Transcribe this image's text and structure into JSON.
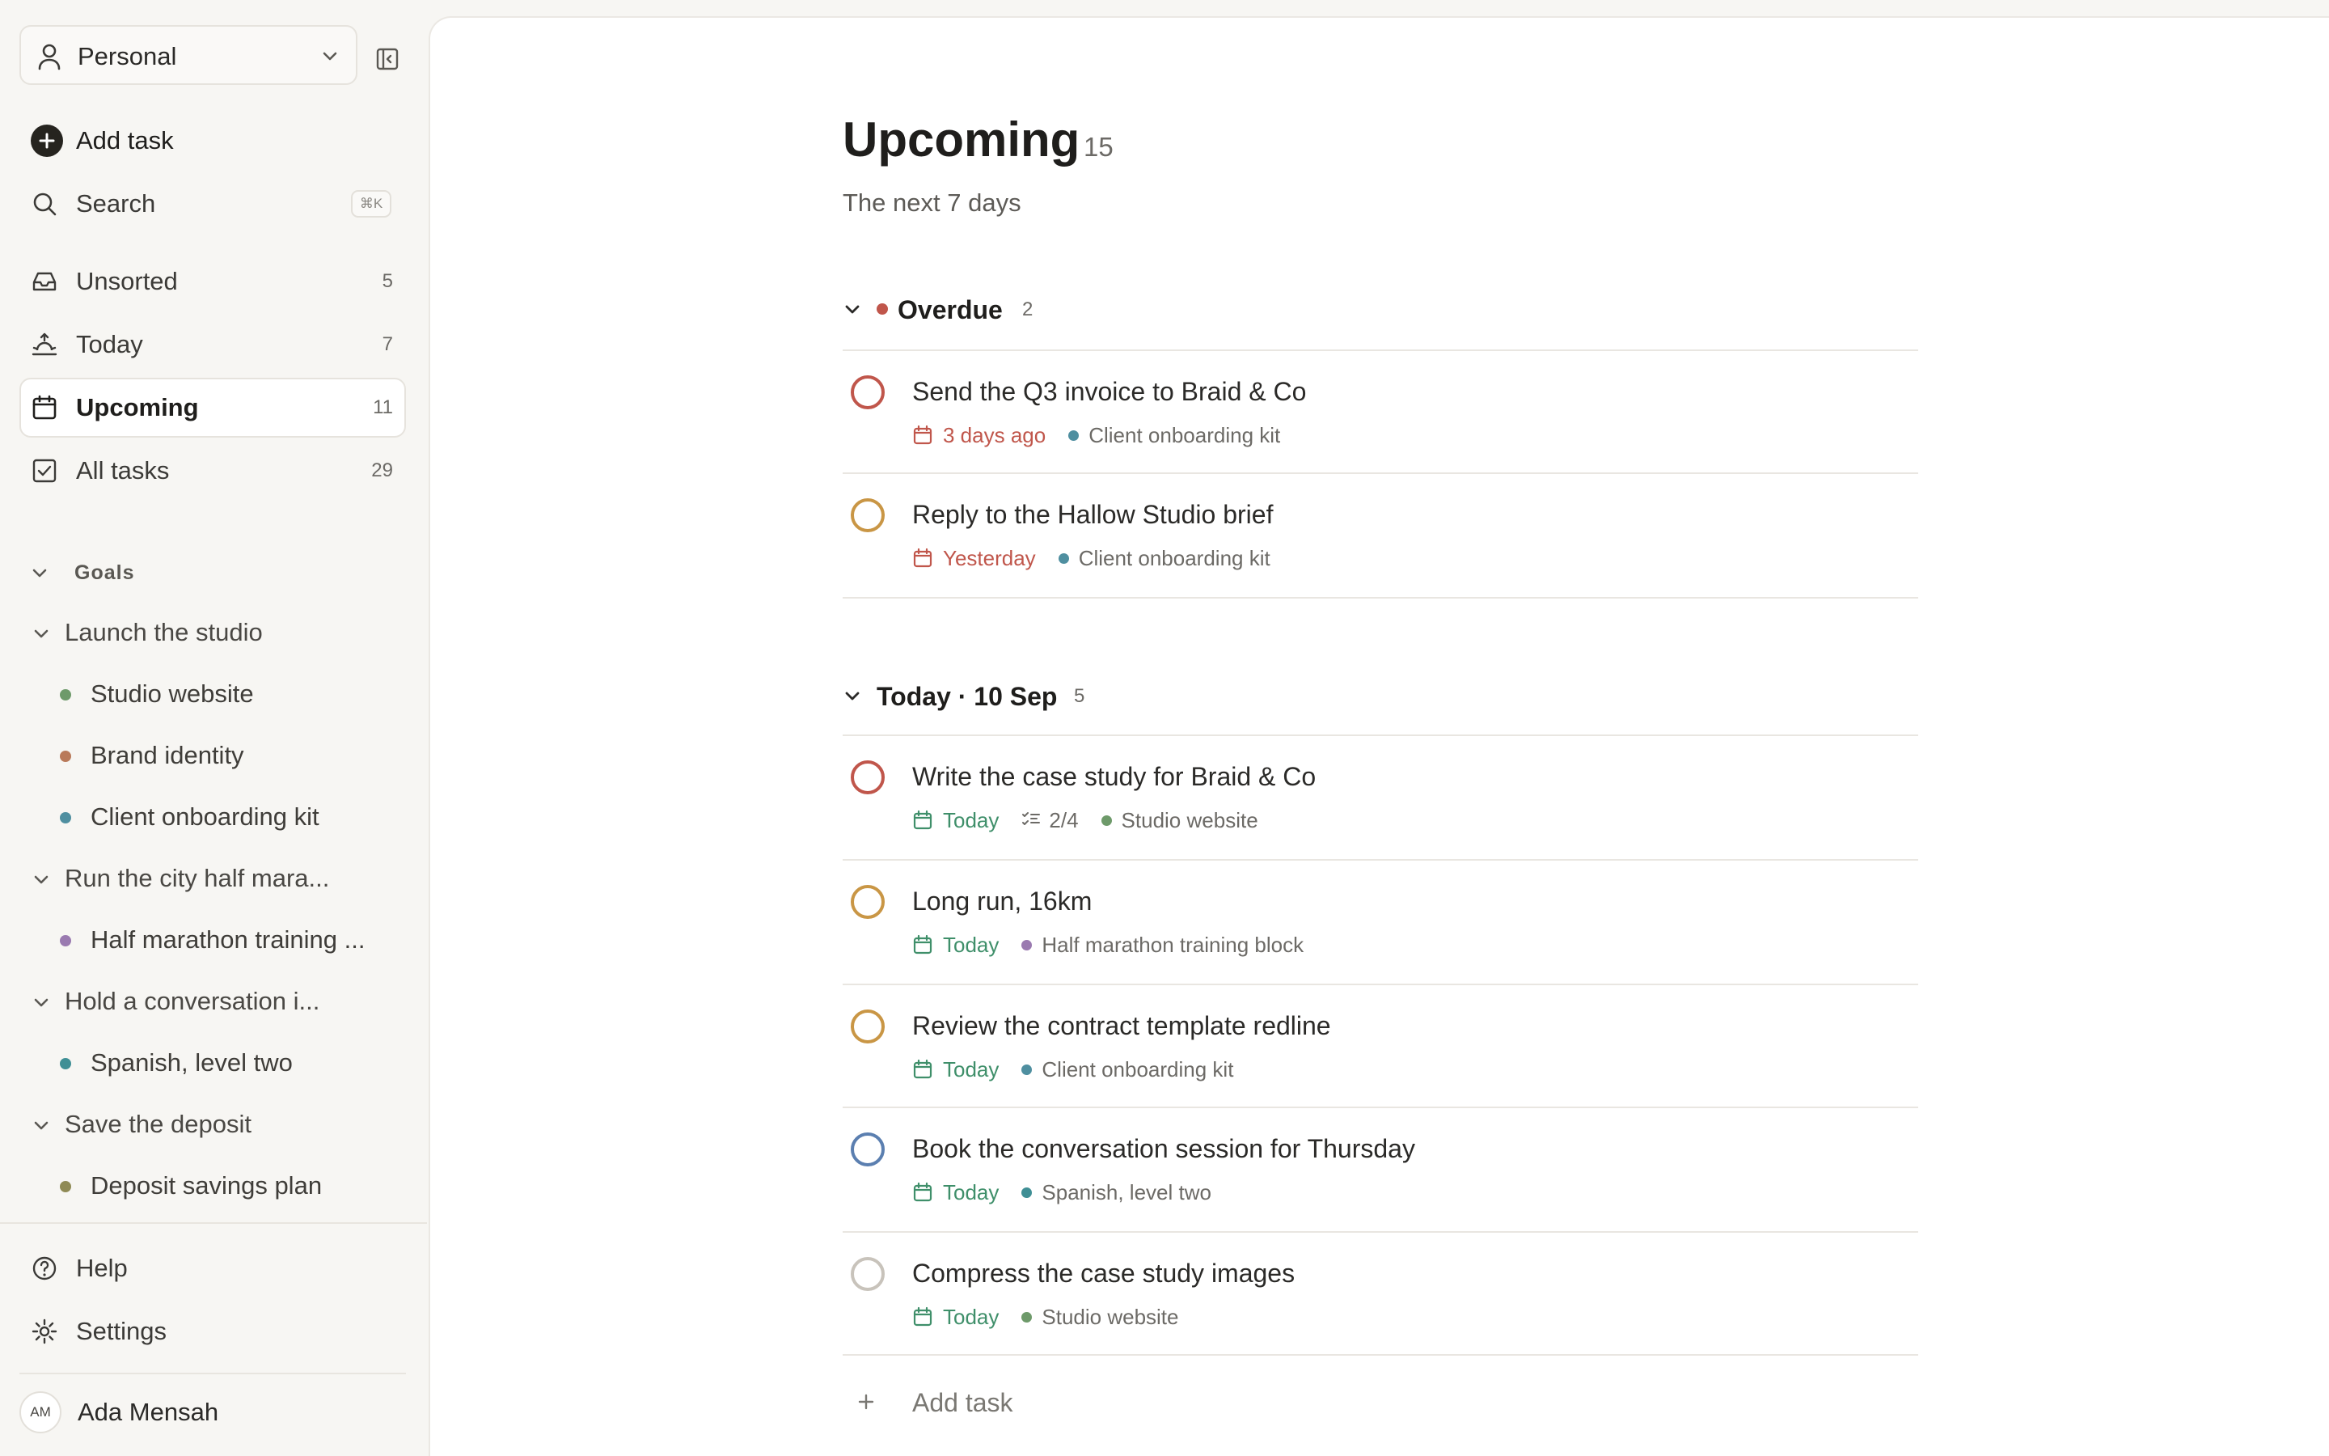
{
  "sidebar": {
    "workspace": {
      "label": "Personal"
    },
    "add_task": {
      "label": "Add task"
    },
    "search": {
      "label": "Search",
      "shortcut": "⌘K"
    },
    "nav": [
      {
        "label": "Unsorted",
        "count": "5",
        "icon": "inbox-icon"
      },
      {
        "label": "Today",
        "count": "7",
        "icon": "sunrise-icon"
      },
      {
        "label": "Upcoming",
        "count": "11",
        "icon": "calendar-icon",
        "active": true
      },
      {
        "label": "All tasks",
        "count": "29",
        "icon": "check-square-icon"
      }
    ],
    "goals_heading": "Goals",
    "goals": [
      {
        "label": "Launch the studio",
        "projects": [
          {
            "label": "Studio website",
            "color": "#6e9a6a"
          },
          {
            "label": "Brand identity",
            "color": "#b97a5a"
          },
          {
            "label": "Client onboarding kit",
            "color": "#4f8fa0"
          }
        ]
      },
      {
        "label": "Run the city half mara...",
        "projects": [
          {
            "label": "Half marathon training ...",
            "color": "#9a7ab0"
          }
        ]
      },
      {
        "label": "Hold a conversation i...",
        "projects": [
          {
            "label": "Spanish, level two",
            "color": "#3f8f95"
          }
        ]
      },
      {
        "label": "Save the deposit",
        "projects": [
          {
            "label": "Deposit savings plan",
            "color": "#8f8a55"
          }
        ]
      }
    ],
    "help": {
      "label": "Help"
    },
    "settings": {
      "label": "Settings"
    },
    "user": {
      "initials": "AM",
      "name": "Ada Mensah"
    }
  },
  "main": {
    "title": "Upcoming",
    "count": "15",
    "subtitle": "The next 7 days",
    "groups": [
      {
        "name": "Overdue",
        "count": "2",
        "tasks": [
          {
            "title": "Send the Q3 invoice to Braid & Co",
            "due": "3 days ago",
            "due_color": "#c0564b",
            "check_color": "#c0564b",
            "project": "Client onboarding kit",
            "project_color": "#4f8fa0"
          },
          {
            "title": "Reply to the Hallow Studio brief",
            "due": "Yesterday",
            "due_color": "#c0564b",
            "check_color": "#c99645",
            "project": "Client onboarding kit",
            "project_color": "#4f8fa0"
          }
        ]
      },
      {
        "name": "Today · 10 Sep",
        "count": "5",
        "tasks": [
          {
            "title": "Write the case study for Braid & Co",
            "due": "Today",
            "due_color": "#3f8f6a",
            "check_color": "#c0564b",
            "subtasks": "2/4",
            "project": "Studio website",
            "project_color": "#6e9a6a"
          },
          {
            "title": "Long run, 16km",
            "due": "Today",
            "due_color": "#3f8f6a",
            "check_color": "#c99645",
            "project": "Half marathon training block",
            "project_color": "#9a7ab0"
          },
          {
            "title": "Review the contract template redline",
            "due": "Today",
            "due_color": "#3f8f6a",
            "check_color": "#c99645",
            "project": "Client onboarding kit",
            "project_color": "#4f8fa0"
          },
          {
            "title": "Book the conversation session for Thursday",
            "due": "Today",
            "due_color": "#3f8f6a",
            "check_color": "#5b7fb0",
            "project": "Spanish, level two",
            "project_color": "#3f8f95"
          },
          {
            "title": "Compress the case study images",
            "due": "Today",
            "due_color": "#3f8f6a",
            "check_color": "#c8c3bb",
            "project": "Studio website",
            "project_color": "#6e9a6a"
          }
        ]
      }
    ],
    "add_task": {
      "label": "Add task"
    }
  }
}
